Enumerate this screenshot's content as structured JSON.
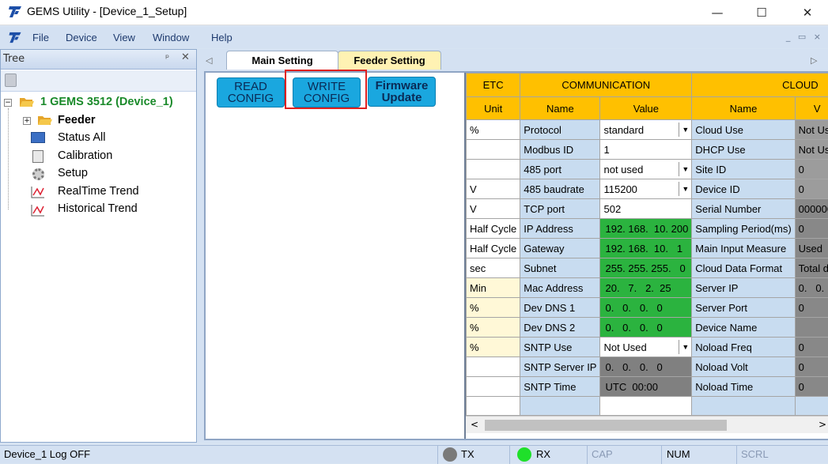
{
  "window": {
    "title": "GEMS Utility - [Device_1_Setup]",
    "minimize": "—",
    "maximize": "☐",
    "close": "✕"
  },
  "menu": [
    "File",
    "Device",
    "View",
    "Window",
    "Help"
  ],
  "mdi_controls": "_ ▭ ×",
  "tree": {
    "header": "Tree",
    "pin": "ᵖ",
    "close": "✕",
    "root": "1 GEMS 3512 (Device_1)",
    "items": [
      "Feeder",
      "Status All",
      "Calibration",
      "Setup",
      "RealTime Trend",
      "Historical Trend"
    ]
  },
  "tabs": {
    "left_arrow": "◁",
    "right_arrow": "▷",
    "main": "Main Setting",
    "feeder": "Feeder Setting"
  },
  "buttons": {
    "read": [
      "READ",
      "CONFIG"
    ],
    "write": [
      "WRITE",
      "CONFIG"
    ],
    "firmware": [
      "Firmware",
      "Update"
    ]
  },
  "grid": {
    "groups": {
      "etc": "ETC",
      "communication": "COMMUNICATION",
      "cloud": "CLOUD"
    },
    "cols": {
      "unit": "Unit",
      "name": "Name",
      "value": "Value",
      "cloud_name": "Name",
      "cloud_value": "V"
    },
    "rows": [
      {
        "unit": "%",
        "name": "Protocol",
        "value": "standard",
        "dd": true,
        "cname": "Cloud Use",
        "cval": "Not Use"
      },
      {
        "unit": "",
        "name": "Modbus ID",
        "value": "1",
        "cname": "DHCP Use",
        "cval": "Not Use"
      },
      {
        "unit": "",
        "name": "485 port",
        "value": "not used",
        "dd": true,
        "cname": "Site ID",
        "cval": "0"
      },
      {
        "unit": "V",
        "name": "485 baudrate",
        "value": "115200",
        "dd": true,
        "cname": "Device ID",
        "cval": "0"
      },
      {
        "unit": "V",
        "name": "TCP port",
        "value": "502",
        "cname": "Serial Number",
        "cval": "000000"
      },
      {
        "unit": "Half Cycle",
        "name": "IP Address",
        "value": "192. 168.  10. 200",
        "green": true,
        "cname": "Sampling Period(ms)",
        "cval": "0"
      },
      {
        "unit": "Half Cycle",
        "name": "Gateway",
        "value": "192. 168.  10.   1",
        "green": true,
        "cname": "Main Input Measure",
        "cval": "Used"
      },
      {
        "unit": "sec",
        "name": "Subnet",
        "value": "255. 255. 255.   0",
        "green": true,
        "cname": "Cloud Data Format",
        "cval": "Total da"
      },
      {
        "unit": "Min",
        "name": "Mac Address",
        "value": "20.   7.   2.  25",
        "green": true,
        "uy": true,
        "cname": "Server IP",
        "cval": "0.   0."
      },
      {
        "unit": "%",
        "name": "Dev DNS 1",
        "value": "0.   0.   0.   0",
        "green": true,
        "uy": true,
        "cname": "Server Port",
        "cval": "0"
      },
      {
        "unit": "%",
        "name": "Dev DNS 2",
        "value": "0.   0.   0.   0",
        "green": true,
        "uy": true,
        "cname": "Device Name",
        "cval": ""
      },
      {
        "unit": "%",
        "name": "SNTP Use",
        "value": "Not Used",
        "dd": true,
        "uy": true,
        "cname": "Noload Freq",
        "cval": "0"
      },
      {
        "unit": "",
        "name": "SNTP Server IP",
        "value": "0.   0.   0.   0",
        "gray": true,
        "cname": "Noload Volt",
        "cval": "0"
      },
      {
        "unit": "",
        "name": "SNTP Time",
        "value": "UTC  00:00",
        "gray": true,
        "cname": "Noload Time",
        "cval": "0"
      }
    ]
  },
  "status": {
    "log": "Device_1 Log OFF",
    "tx": "TX",
    "rx": "RX",
    "cap": "CAP",
    "num": "NUM",
    "scrl": "SCRL"
  },
  "colors": {
    "highlight": "#e0201f",
    "green_led": "#1fe02a",
    "gray_led": "#7a7a7a"
  }
}
